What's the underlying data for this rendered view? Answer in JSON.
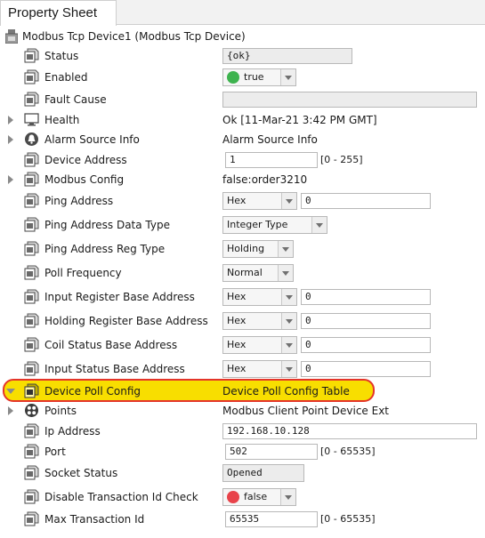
{
  "tab": {
    "label": "Property Sheet"
  },
  "header": {
    "title": "Modbus Tcp Device1  (Modbus Tcp Device)"
  },
  "rows": [
    {
      "name": "Status",
      "value": "{ok}"
    },
    {
      "name": "Enabled",
      "value": "true",
      "dot_color": "#3eb34f"
    },
    {
      "name": "Fault Cause",
      "value": ""
    },
    {
      "name": "Health",
      "value": "Ok [11-Mar-21 3:42 PM GMT]"
    },
    {
      "name": "Alarm Source Info",
      "value": "Alarm Source Info"
    },
    {
      "name": "Device Address",
      "value": "1",
      "range": "[0 - 255]"
    },
    {
      "name": "Modbus Config",
      "value": "false:order3210"
    },
    {
      "name": "Ping Address",
      "format": "Hex",
      "value": "0"
    },
    {
      "name": "Ping Address Data Type",
      "value": "Integer Type"
    },
    {
      "name": "Ping Address Reg Type",
      "value": "Holding"
    },
    {
      "name": "Poll Frequency",
      "value": "Normal"
    },
    {
      "name": "Input Register Base Address",
      "format": "Hex",
      "value": "0"
    },
    {
      "name": "Holding Register Base Address",
      "format": "Hex",
      "value": "0"
    },
    {
      "name": "Coil Status Base Address",
      "format": "Hex",
      "value": "0"
    },
    {
      "name": "Input Status Base Address",
      "format": "Hex",
      "value": "0"
    },
    {
      "name": "Device Poll Config",
      "value": "Device Poll Config Table"
    },
    {
      "name": "Points",
      "value": "Modbus Client Point Device Ext"
    },
    {
      "name": "Ip Address",
      "value": "192.168.10.128"
    },
    {
      "name": "Port",
      "value": "502",
      "range": "[0 - 65535]"
    },
    {
      "name": "Socket Status",
      "value": "Opened"
    },
    {
      "name": "Disable Transaction Id Check",
      "value": "false",
      "dot_color": "#e8434a"
    },
    {
      "name": "Max Transaction Id",
      "value": "65535",
      "range": "[0 - 65535]"
    }
  ],
  "colors": {
    "highlight_fill": "#f8de00",
    "highlight_border": "#e4352a"
  }
}
